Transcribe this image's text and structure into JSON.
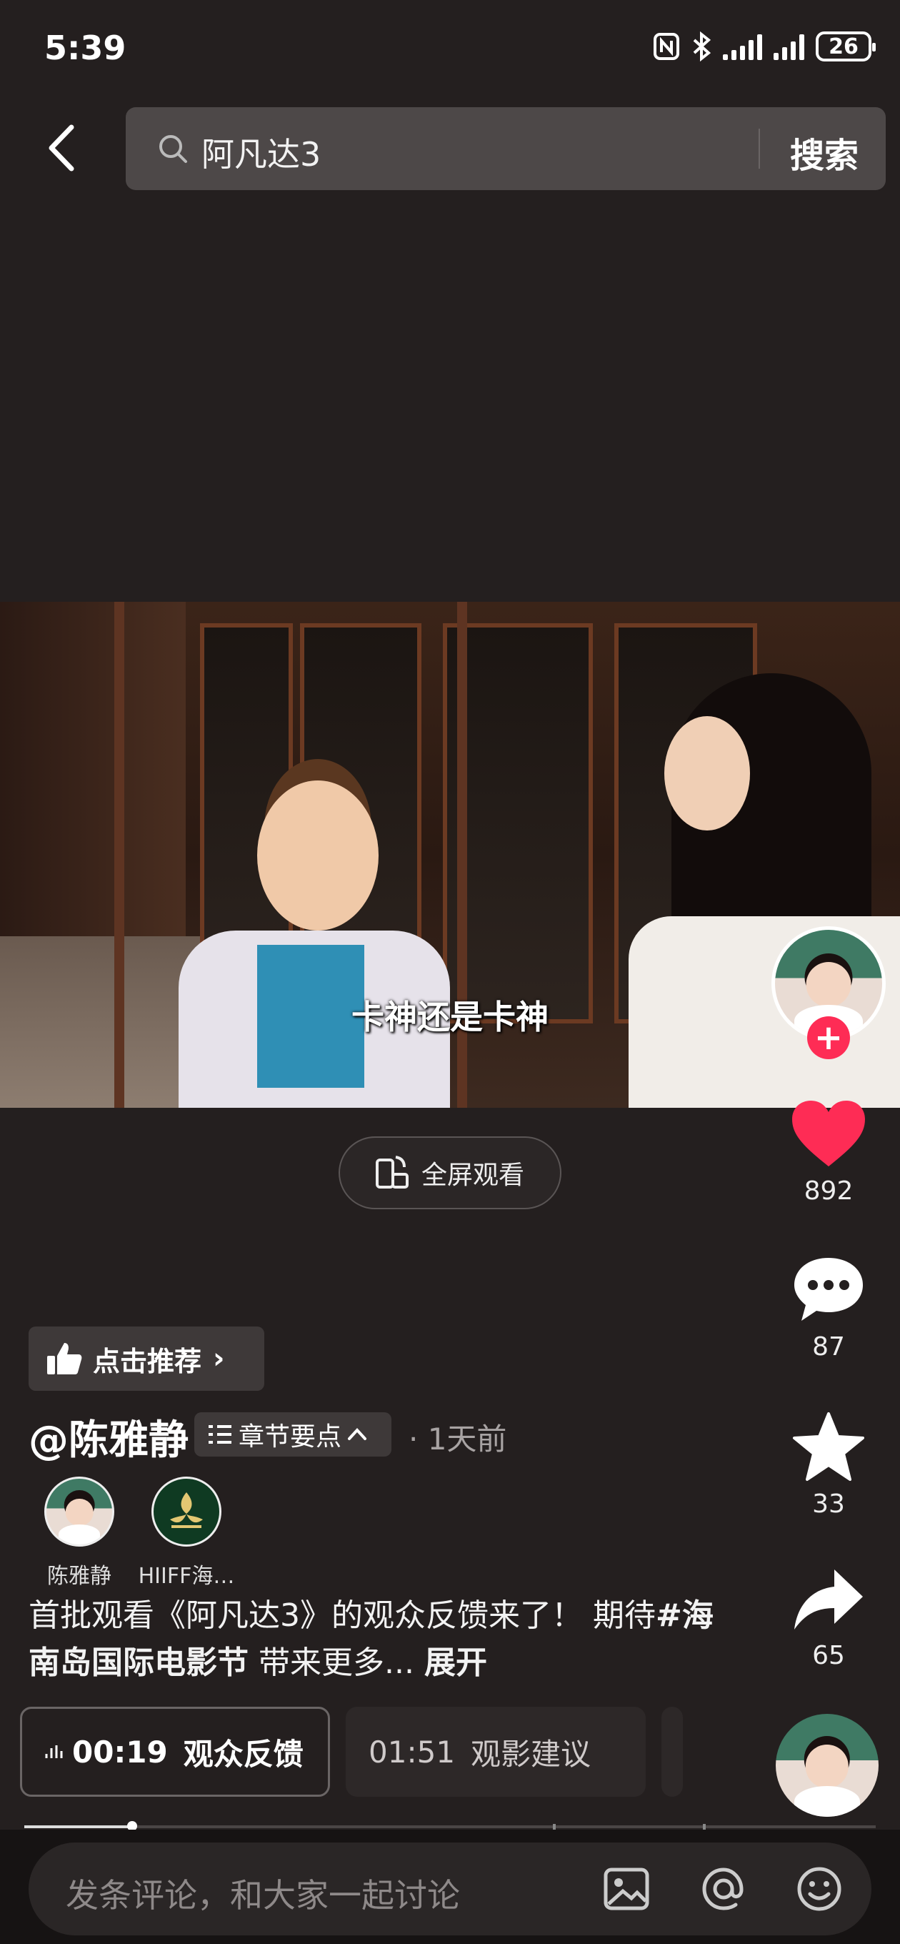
{
  "status_bar": {
    "time": "5:39",
    "battery": "26"
  },
  "search": {
    "query": "阿凡达3",
    "button": "搜索"
  },
  "video": {
    "subtitle": "卡神还是卡神",
    "fullscreen_label": "全屏观看"
  },
  "actions": {
    "likes": "892",
    "comments": "87",
    "favorites": "33",
    "shares": "65"
  },
  "recommend_label": "点击推荐",
  "author": {
    "handle": "@陈雅静",
    "chapters_label": "章节要点",
    "time_ago": "· 1天前"
  },
  "co_creators": [
    {
      "name": "陈雅静"
    },
    {
      "name": "HIIFF海…"
    }
  ],
  "caption": {
    "text_before": "首批观看《阿凡达3》的观众反馈来了！ 期待",
    "hashtag": "#海南岛国际电影节",
    "text_after": " 带来更多...",
    "expand": "展开"
  },
  "chapter_cards": [
    {
      "time": "00:19",
      "title": "观众反馈",
      "active": true
    },
    {
      "time": "01:51",
      "title": "观影建议",
      "active": false
    }
  ],
  "comment_bar": {
    "placeholder": "发条评论，和大家一起讨论"
  },
  "colors": {
    "accent": "#fe2c55",
    "background": "#241f1f"
  }
}
